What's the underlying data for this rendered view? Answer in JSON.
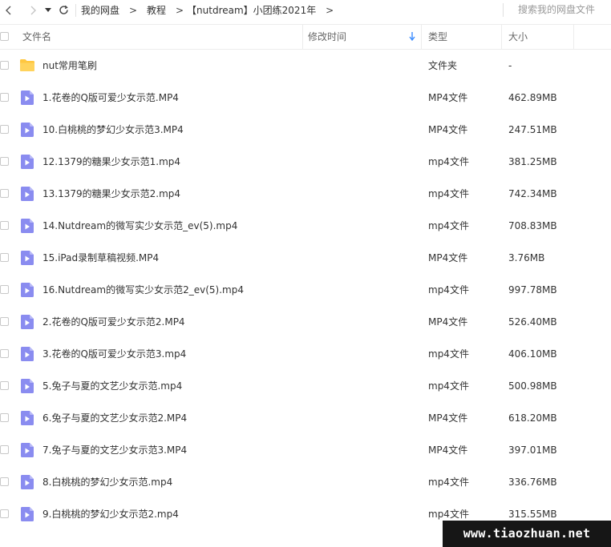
{
  "nav": {
    "breadcrumbs": [
      {
        "label": "我的网盘"
      },
      {
        "label": "教程"
      },
      {
        "label": "【nutdream】小团练2021年"
      }
    ],
    "crumb_arrow": ">",
    "search_placeholder": "搜索我的网盘文件"
  },
  "columns": {
    "name": "文件名",
    "modified": "修改时间",
    "type": "类型",
    "size": "大小"
  },
  "colors": {
    "accent": "#3b8cff",
    "folder": "#ffc740",
    "video_icon": "#8a8cf0"
  },
  "files": [
    {
      "name": "nut常用笔刷",
      "type": "文件夹",
      "size": "-",
      "icon": "folder-icon"
    },
    {
      "name": "1.花卷的Q版可爱少女示范.MP4",
      "type": "MP4文件",
      "size": "462.89MB",
      "icon": "video-file-icon"
    },
    {
      "name": "10.白桃桃的梦幻少女示范3.MP4",
      "type": "MP4文件",
      "size": "247.51MB",
      "icon": "video-file-icon"
    },
    {
      "name": "12.1379的糖果少女示范1.mp4",
      "type": "mp4文件",
      "size": "381.25MB",
      "icon": "video-file-icon"
    },
    {
      "name": "13.1379的糖果少女示范2.mp4",
      "type": "mp4文件",
      "size": "742.34MB",
      "icon": "video-file-icon"
    },
    {
      "name": "14.Nutdream的微写实少女示范_ev(5).mp4",
      "type": "mp4文件",
      "size": "708.83MB",
      "icon": "video-file-icon"
    },
    {
      "name": "15.iPad录制草稿视频.MP4",
      "type": "MP4文件",
      "size": "3.76MB",
      "icon": "video-file-icon"
    },
    {
      "name": "16.Nutdream的微写实少女示范2_ev(5).mp4",
      "type": "mp4文件",
      "size": "997.78MB",
      "icon": "video-file-icon"
    },
    {
      "name": "2.花卷的Q版可爱少女示范2.MP4",
      "type": "MP4文件",
      "size": "526.40MB",
      "icon": "video-file-icon"
    },
    {
      "name": "3.花卷的Q版可爱少女示范3.mp4",
      "type": "mp4文件",
      "size": "406.10MB",
      "icon": "video-file-icon"
    },
    {
      "name": "5.兔子与夏的文艺少女示范.mp4",
      "type": "mp4文件",
      "size": "500.98MB",
      "icon": "video-file-icon"
    },
    {
      "name": "6.兔子与夏的文艺少女示范2.MP4",
      "type": "MP4文件",
      "size": "618.20MB",
      "icon": "video-file-icon"
    },
    {
      "name": "7.兔子与夏的文艺少女示范3.MP4",
      "type": "MP4文件",
      "size": "397.01MB",
      "icon": "video-file-icon"
    },
    {
      "name": "8.白桃桃的梦幻少女示范.mp4",
      "type": "mp4文件",
      "size": "336.76MB",
      "icon": "video-file-icon"
    },
    {
      "name": "9.白桃桃的梦幻少女示范2.mp4",
      "type": "mp4文件",
      "size": "315.55MB",
      "icon": "video-file-icon"
    }
  ],
  "watermark": "www.tiaozhuan.net"
}
